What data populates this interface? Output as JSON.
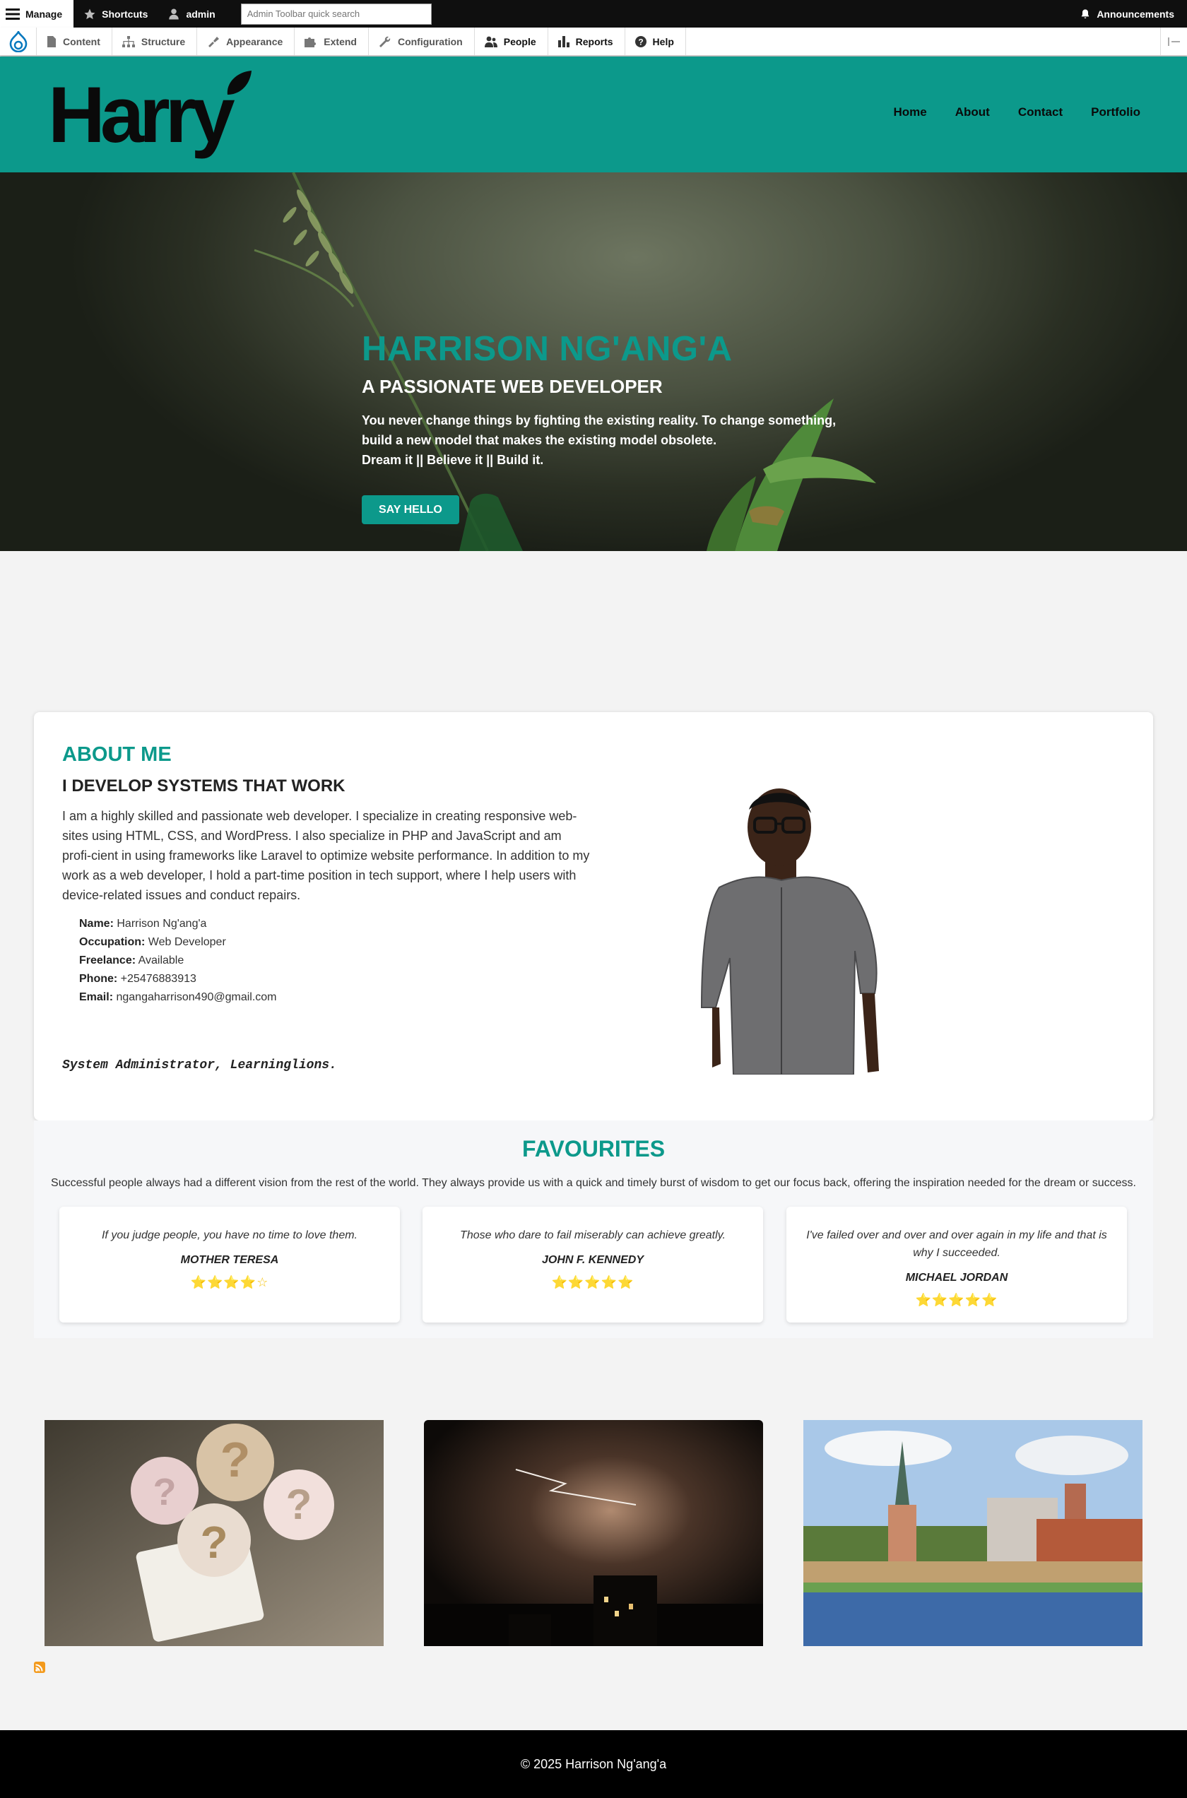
{
  "admin_toolbar": {
    "manage": "Manage",
    "shortcuts": "Shortcuts",
    "user": "admin",
    "search_placeholder": "Admin Toolbar quick search",
    "announcements": "Announcements",
    "menu": [
      "Content",
      "Structure",
      "Appearance",
      "Extend",
      "Configuration",
      "People",
      "Reports",
      "Help"
    ]
  },
  "site": {
    "logo_text": "Harry",
    "nav": [
      "Home",
      "About",
      "Contact",
      "Portfolio"
    ]
  },
  "hero": {
    "title": "HARRISON NG'ANG'A",
    "subtitle": "A PASSIONATE WEB DEVELOPER",
    "line1": "You never change things by fighting the existing reality. To change something,",
    "line2": "build a new model that makes the existing model obsolete.",
    "line3": "Dream it || Believe it || Build it.",
    "button": "SAY HELLO"
  },
  "about": {
    "title": "ABOUT ME",
    "subtitle": "I DEVELOP SYSTEMS THAT WORK",
    "text": "I am a highly skilled and passionate web developer. I specialize in creating responsive web-sites using HTML, CSS, and WordPress. I also specialize in PHP and JavaScript and am profi-cient in using frameworks like Laravel to optimize website performance. In addition to my work as a web developer, I hold a part-time position in tech support, where I help users with device-related issues and conduct repairs.",
    "details": [
      {
        "label": "Name:",
        "value": "Harrison Ng'ang'a"
      },
      {
        "label": "Occupation:",
        "value": "Web Developer"
      },
      {
        "label": "Freelance:",
        "value": "Available"
      },
      {
        "label": "Phone:",
        "value": "+25476883913"
      },
      {
        "label": "Email:",
        "value": "ngangaharrison490@gmail.com"
      }
    ],
    "signature": "System Administrator, Learninglions."
  },
  "favourites": {
    "title": "FAVOURITES",
    "description": "Successful people always had a different vision from the rest of the world. They always provide us with a quick and timely burst of wisdom to get our focus back, offering the inspiration needed for the dream or success.",
    "quotes": [
      {
        "text": "If you judge people, you have no time to love them.",
        "author": "MOTHER TERESA",
        "stars": "⭐⭐⭐⭐☆",
        "rating": 4
      },
      {
        "text": "Those who dare to fail miserably can achieve greatly.",
        "author": "JOHN F. KENNEDY",
        "stars": "⭐⭐⭐⭐⭐",
        "rating": 5
      },
      {
        "text": "I've failed over and over and over again in my life and that is why I succeeded.",
        "author": "MICHAEL JORDAN",
        "stars": "⭐⭐⭐⭐⭐",
        "rating": 5
      }
    ]
  },
  "gallery": [
    "question-marks-photo",
    "lightning-storm-photo",
    "riverside-city-photo"
  ],
  "footer": {
    "copyright": "© 2025 Harrison Ng'ang'a"
  },
  "colors": {
    "accent": "#0c998b",
    "toolbar": "#0f0f0f",
    "footer": "#000000",
    "stars": "#f5c518"
  }
}
